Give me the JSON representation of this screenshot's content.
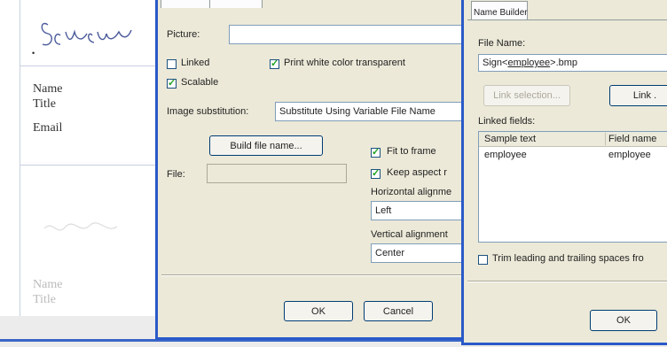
{
  "background_doc": {
    "name1": "Name",
    "title1": "Title",
    "email1": "Email",
    "name2": "Name",
    "title2": "Title"
  },
  "picture_dialog": {
    "picture_label": "Picture:",
    "linked_label": "Linked",
    "linked_checked": false,
    "print_white_label": "Print white color transparent",
    "print_white_checked": true,
    "scalable_label": "Scalable",
    "scalable_checked": true,
    "image_sub_label": "Image substitution:",
    "image_sub_value": "Substitute Using Variable File Name",
    "build_button": "Build file name...",
    "file_label": "File:",
    "fit_label": "Fit to frame",
    "fit_checked": true,
    "keep_label": "Keep aspect r",
    "keep_checked": true,
    "halign_label": "Horizontal alignme",
    "halign_value": "Left",
    "valign_label": "Vertical alignment",
    "valign_value": "Center",
    "ok": "OK",
    "cancel": "Cancel"
  },
  "name_builder": {
    "tab": "Name Builder",
    "file_name_label": "File Name:",
    "file_name_prefix": "Sign<",
    "file_name_field": "employee",
    "file_name_suffix": ">.bmp",
    "link_selection": "Link selection...",
    "link_button": "Link .",
    "linked_fields_label": "Linked fields:",
    "columns": [
      "Sample text",
      "Field name"
    ],
    "rows": [
      [
        "employee",
        "employee"
      ]
    ],
    "trim_label": "Trim leading and trailing spaces fro",
    "trim_checked": false,
    "ok": "OK"
  }
}
